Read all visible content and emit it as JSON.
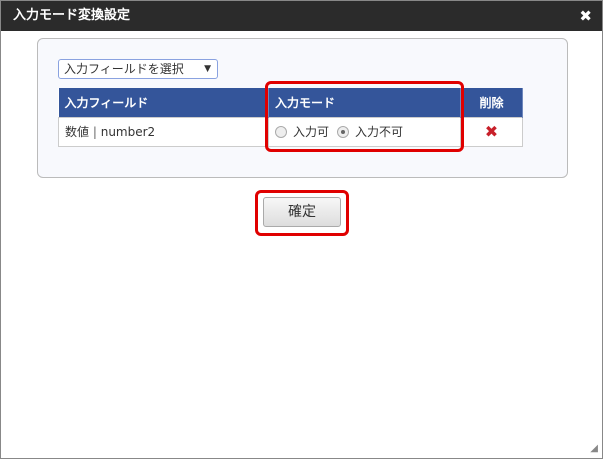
{
  "dialog": {
    "title": "入力モード変換設定",
    "close": "✖"
  },
  "select": {
    "value": "入力フィールドを選択",
    "arrow": "▼"
  },
  "table": {
    "headers": [
      "入力フィールド",
      "入力モード",
      "削除"
    ],
    "rows": [
      {
        "field_type": "数値",
        "sep": "|",
        "field_name": "number2",
        "options": [
          "入力可",
          "入力不可"
        ],
        "selected": "入力不可",
        "delete": "✖"
      }
    ]
  },
  "confirm_label": "確定",
  "resize": "◢"
}
